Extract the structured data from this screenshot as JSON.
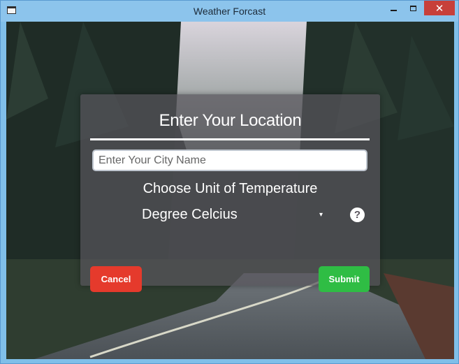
{
  "window": {
    "title": "Weather Forcast",
    "minimize_label": "",
    "maximize_label": "",
    "close_label": "✕"
  },
  "form": {
    "heading": "Enter Your Location",
    "city_placeholder": "Enter Your City Name",
    "city_value": "",
    "unit_label": "Choose Unit of Temperature",
    "unit_selected": "Degree Celcius",
    "dropdown_arrow": "▾",
    "help_glyph": "?",
    "cancel_label": "Cancel",
    "submit_label": "Submit"
  },
  "colors": {
    "cancel": "#e53a2c",
    "submit": "#2fbd44",
    "panel": "#58545c",
    "close_button": "#c7403a"
  }
}
